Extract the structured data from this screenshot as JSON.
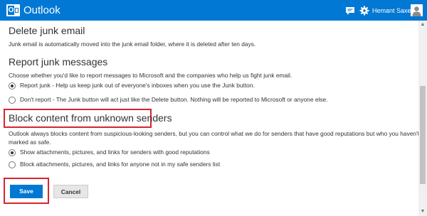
{
  "header": {
    "app_title": "Outlook",
    "user_name": "Hemant Saxena",
    "icons": [
      "outlook-logo-icon",
      "chat-icon",
      "gear-icon",
      "avatar-icon"
    ]
  },
  "settings": {
    "delete_junk": {
      "heading": "Delete junk email",
      "description": "Junk email is automatically moved into the junk email folder, where it is deleted after ten days."
    },
    "report_junk": {
      "heading": "Report junk messages",
      "description": "Choose whether you'd like to report messages to Microsoft and the companies who help us fight junk email.",
      "options": [
        {
          "label": "Report junk - Help us keep junk out of everyone's inboxes when you use the Junk button.",
          "selected": true
        },
        {
          "label": "Don't report - The Junk button will act just like the Delete button. Nothing will be reported to Microsoft or anyone else.",
          "selected": false
        }
      ]
    },
    "block_content": {
      "heading": "Block content from unknown senders",
      "description_line1": "Outlook always blocks content from suspicious-looking senders, but you can control what we do for senders that have good reputations but who you haven't",
      "description_line2": "marked as safe.",
      "options": [
        {
          "label": "Show attachments, pictures, and links for senders with good reputations",
          "selected": true
        },
        {
          "label": "Block attachments, pictures, and links for anyone not in my safe senders list",
          "selected": false
        }
      ]
    }
  },
  "actions": {
    "save_label": "Save",
    "cancel_label": "Cancel"
  },
  "colors": {
    "header_bg": "#0078d4",
    "highlight_border": "#d9232e",
    "primary_button": "#0078d4"
  }
}
